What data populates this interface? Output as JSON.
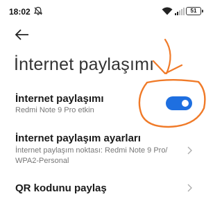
{
  "status_bar": {
    "time": "18:02",
    "battery": "51",
    "icons": [
      "dnd-icon",
      "wifi-icon",
      "signal-icon",
      "battery-icon"
    ]
  },
  "header": {
    "back_icon": "back-arrow-icon",
    "title": "İnternet paylaşımı"
  },
  "rows": {
    "hotspot": {
      "title": "İnternet paylaşımı",
      "subtitle": "Redmi Note 9 Pro etkin",
      "toggle_on": true
    },
    "settings": {
      "title": "İnternet paylaşım ayarları",
      "subtitle": "İnternet paylaşım noktası: Redmi Note 9 Pro/ WPA2-Personal"
    },
    "qr": {
      "title": "QR kodunu paylaş"
    }
  },
  "colors": {
    "toggle_on": "#1e6fe0",
    "annotation": "#f07a28"
  }
}
